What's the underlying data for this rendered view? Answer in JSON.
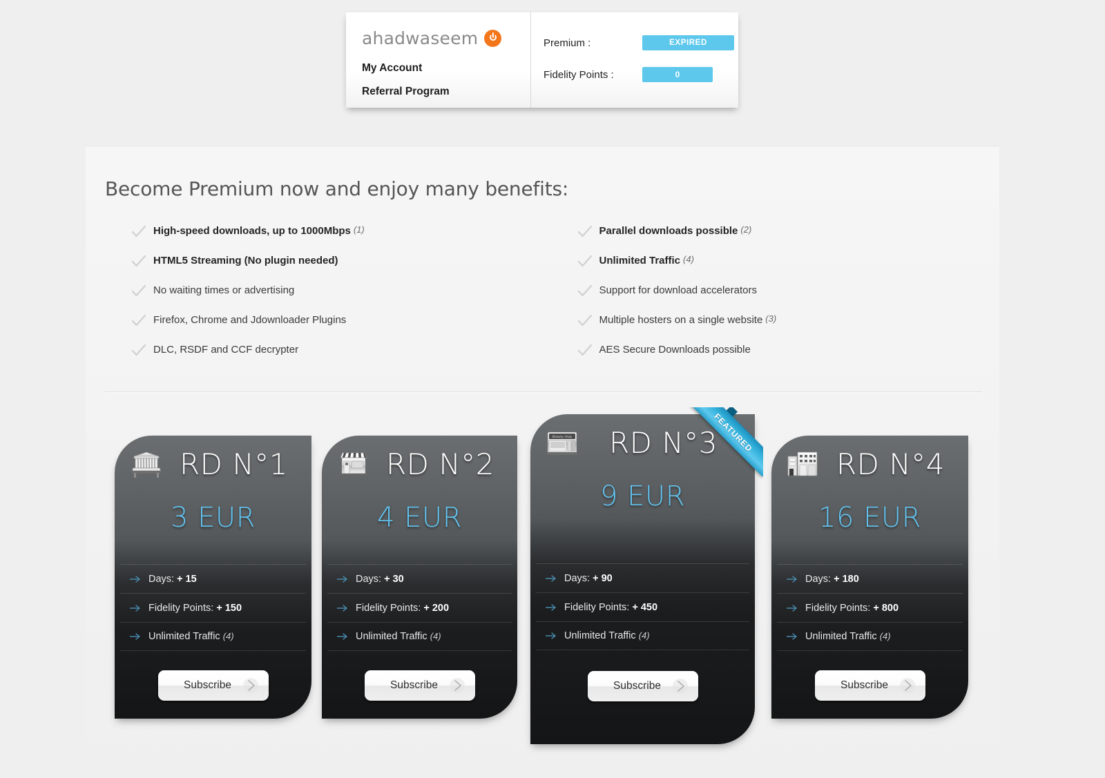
{
  "account": {
    "brand": "ahadwaseem",
    "power_icon": "power-icon",
    "links": [
      {
        "label": "My Account"
      },
      {
        "label": "Referral Program"
      }
    ],
    "stats": [
      {
        "label": "Premium :",
        "value": "EXPIRED",
        "type": "expired"
      },
      {
        "label": "Fidelity Points :",
        "value": "0",
        "type": "points"
      }
    ],
    "badge_color": "#5ec8ec"
  },
  "main": {
    "title": "Become Premium now and enjoy many benefits:",
    "benefits_left": [
      {
        "text": "High-speed downloads, up to 1000Mbps",
        "note": "(1)",
        "bold": true
      },
      {
        "text": "HTML5 Streaming (No plugin needed)",
        "note": "",
        "bold": true
      },
      {
        "text": "No waiting times or advertising",
        "note": "",
        "bold": false
      },
      {
        "text": "Firefox, Chrome and Jdownloader Plugins",
        "note": "",
        "bold": false
      },
      {
        "text": "DLC, RSDF and CCF decrypter",
        "note": "",
        "bold": false
      }
    ],
    "benefits_right": [
      {
        "text": "Parallel downloads possible",
        "note": "(2)",
        "bold": true
      },
      {
        "text": "Unlimited Traffic",
        "note": "(4)",
        "bold": true
      },
      {
        "text": "Support for download accelerators",
        "note": "",
        "bold": false
      },
      {
        "text": "Multiple hosters on a single website",
        "note": "(3)",
        "bold": false
      },
      {
        "text": "AES Secure Downloads possible",
        "note": "",
        "bold": false
      }
    ],
    "check_icon": "checkmark-icon",
    "accent_price_color": "#62c3ef"
  },
  "plans": [
    {
      "title": "RD N°1",
      "price": "3 EUR",
      "icon": "bench-icon",
      "featured": false,
      "ribbon_label": "",
      "features": [
        {
          "label": "Days: ",
          "value": "+ 15",
          "note": ""
        },
        {
          "label": "Fidelity Points: ",
          "value": "+ 150",
          "note": ""
        },
        {
          "label": "Unlimited Traffic ",
          "value": "",
          "note": "(4)"
        }
      ],
      "cta": "Subscribe"
    },
    {
      "title": "RD N°2",
      "price": "4 EUR",
      "icon": "storefront-icon",
      "featured": false,
      "ribbon_label": "",
      "features": [
        {
          "label": "Days: ",
          "value": "+ 30",
          "note": ""
        },
        {
          "label": "Fidelity Points: ",
          "value": "+ 200",
          "note": ""
        },
        {
          "label": "Unlimited Traffic ",
          "value": "",
          "note": "(4)"
        }
      ],
      "cta": "Subscribe"
    },
    {
      "title": "RD N°3",
      "price": "9 EUR",
      "icon": "shop-counter-icon",
      "featured": true,
      "ribbon_label": "FEATURED",
      "features": [
        {
          "label": "Days: ",
          "value": "+ 90",
          "note": ""
        },
        {
          "label": "Fidelity Points: ",
          "value": "+ 450",
          "note": ""
        },
        {
          "label": "Unlimited Traffic ",
          "value": "",
          "note": "(4)"
        }
      ],
      "cta": "Subscribe"
    },
    {
      "title": "RD N°4",
      "price": "16 EUR",
      "icon": "office-building-icon",
      "featured": false,
      "ribbon_label": "",
      "features": [
        {
          "label": "Days: ",
          "value": "+ 180",
          "note": ""
        },
        {
          "label": "Fidelity Points: ",
          "value": "+ 800",
          "note": ""
        },
        {
          "label": "Unlimited Traffic ",
          "value": "",
          "note": "(4)"
        }
      ],
      "cta": "Subscribe"
    }
  ]
}
